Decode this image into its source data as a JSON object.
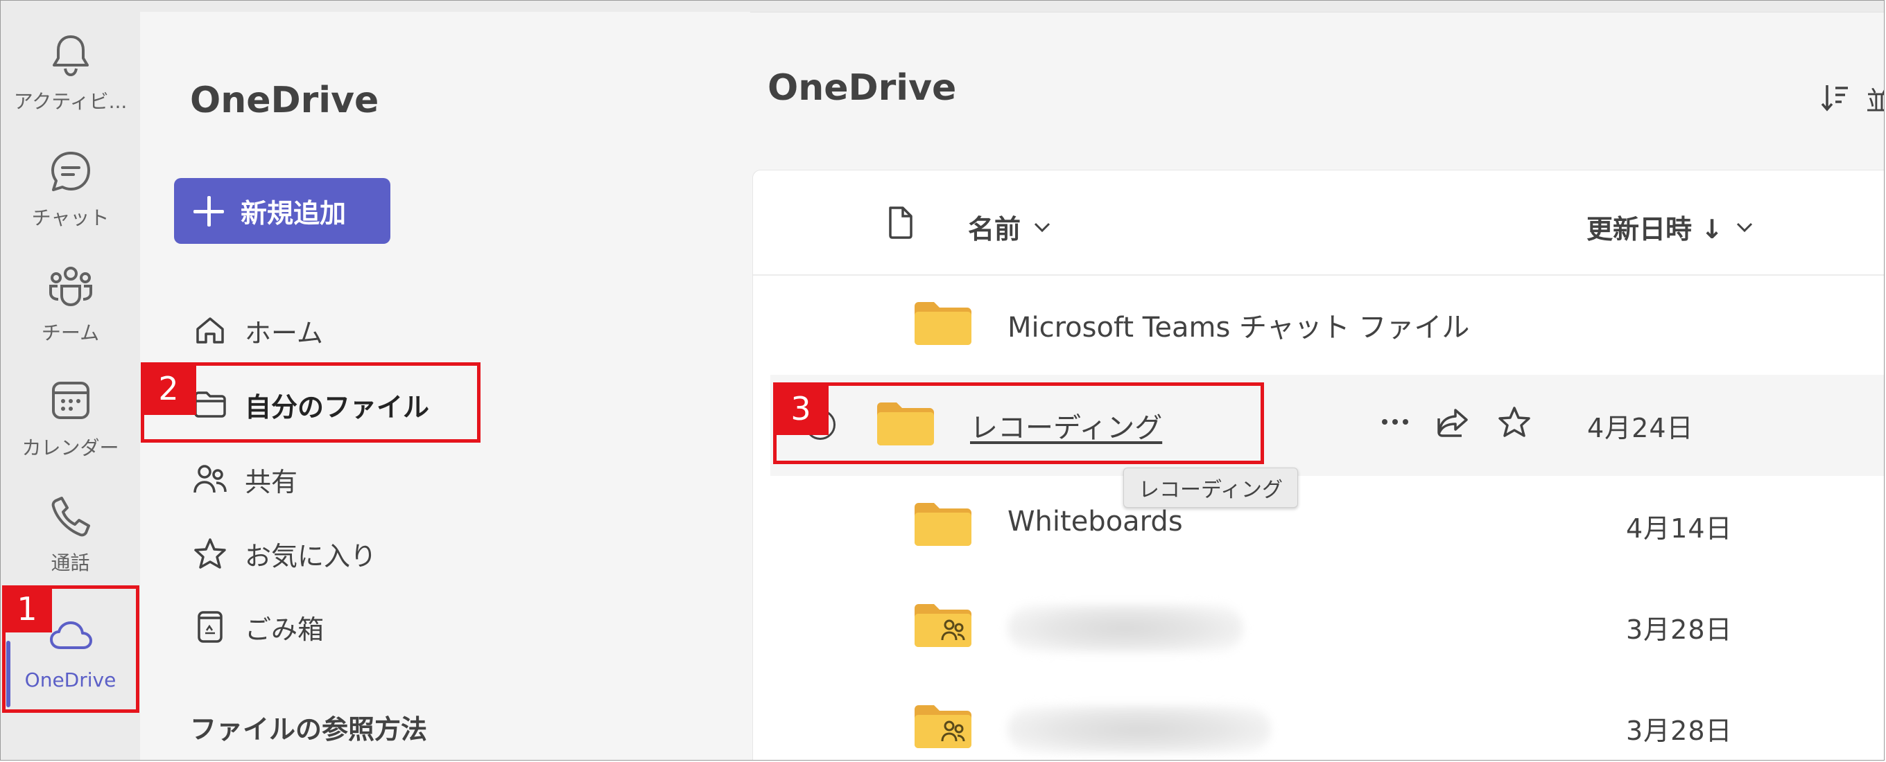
{
  "rail": {
    "items": [
      {
        "label": "アクティビ...",
        "icon": "bell-icon"
      },
      {
        "label": "チャット",
        "icon": "chat-icon"
      },
      {
        "label": "チーム",
        "icon": "teams-icon"
      },
      {
        "label": "カレンダー",
        "icon": "calendar-icon"
      },
      {
        "label": "通話",
        "icon": "phone-icon"
      },
      {
        "label": "OneDrive",
        "icon": "cloud-icon",
        "active": true
      }
    ],
    "more_icon": "ellipsis-icon"
  },
  "left_pane": {
    "title": "OneDrive",
    "new_button": "新規追加",
    "nav": [
      {
        "label": "ホーム",
        "icon": "home-icon"
      },
      {
        "label": "自分のファイル",
        "icon": "folder-icon",
        "selected": true
      },
      {
        "label": "共有",
        "icon": "people-icon"
      },
      {
        "label": "お気に入り",
        "icon": "star-icon"
      },
      {
        "label": "ごみ箱",
        "icon": "recycle-bin-icon"
      }
    ],
    "section_title": "ファイルの参照方法"
  },
  "main": {
    "title": "OneDrive",
    "sort_label": "並",
    "columns": {
      "type_icon": "file-icon",
      "name": "名前",
      "modified": "更新日時 ↓"
    },
    "rows": [
      {
        "name": "Microsoft Teams チャット ファイル",
        "date": "",
        "icon": "folder-icon"
      },
      {
        "name": "レコーディング",
        "date": "4月24日",
        "icon": "folder-icon",
        "hover": true
      },
      {
        "name": "Whiteboards",
        "date": "4月14日",
        "icon": "folder-icon"
      },
      {
        "name": "",
        "date": "3月28日",
        "icon": "shared-folder-icon",
        "blurred": true
      },
      {
        "name": "",
        "date": "3月28日",
        "icon": "shared-folder-icon",
        "blurred": true
      }
    ],
    "tooltip": "レコーディング"
  },
  "annotations": {
    "one": "1",
    "two": "2",
    "three": "3",
    "color": "#e5141c"
  },
  "colors": {
    "accent": "#5b5fc7",
    "folder": "#f8c94c",
    "folder_back": "#e9a93a"
  }
}
